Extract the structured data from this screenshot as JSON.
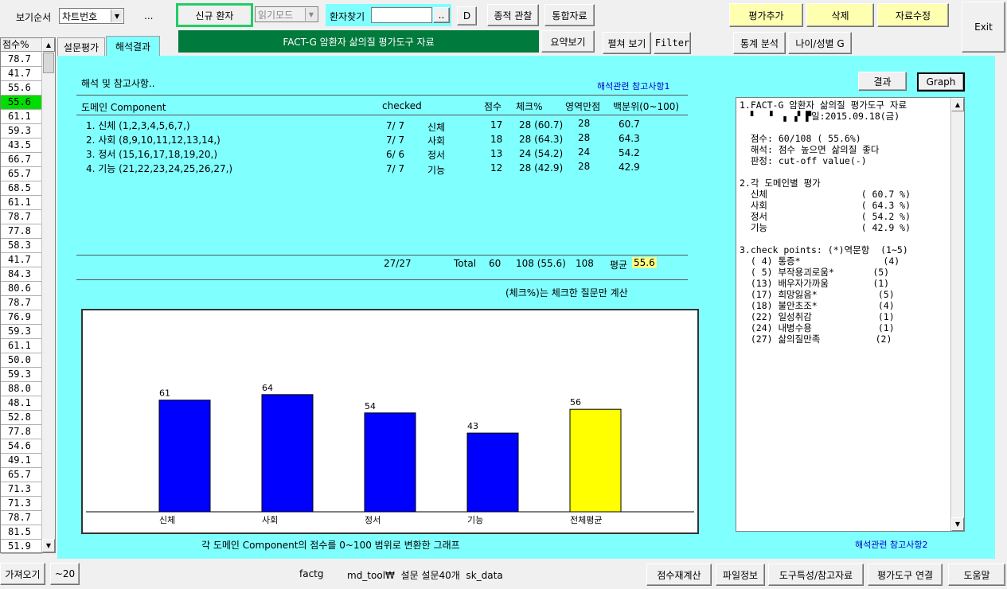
{
  "toolbar": {
    "sort_label": "보기순서",
    "sort_value": "차트번호",
    "ellipsis": "...",
    "new_patient": "신규 환자",
    "read_mode": "읽기모드",
    "search_label": "환자찾기",
    "search_value": "",
    "search_more": "..",
    "d_button": "D",
    "trend": "종적 관찰",
    "integrated": "통합자료",
    "add_eval": "평가추가",
    "delete": "삭제",
    "edit_data": "자료수정",
    "exit": "Exit",
    "title_banner": "FACT-G 암환자 삶의질 평가도구 자료",
    "summary": "요약보기",
    "expand": "펼쳐 보기",
    "filter": "Filter",
    "stats": "통계 분석",
    "age_sex": "나이/성별 G"
  },
  "score_list": {
    "header": "점수%",
    "selected_index": 3,
    "values": [
      "78.7",
      "41.7",
      "55.6",
      "55.6",
      "61.1",
      "59.3",
      "43.5",
      "66.7",
      "65.7",
      "68.5",
      "61.1",
      "78.7",
      "77.8",
      "58.3",
      "41.7",
      "84.3",
      "80.6",
      "78.7",
      "76.9",
      "59.3",
      "61.1",
      "50.0",
      "59.3",
      "88.0",
      "48.1",
      "52.8",
      "77.8",
      "54.6",
      "49.1",
      "65.7",
      "71.3",
      "71.3",
      "78.7",
      "81.5",
      "51.9"
    ]
  },
  "tabs": [
    {
      "label": "설문평가"
    },
    {
      "label": "해석결과"
    }
  ],
  "interpretation": {
    "heading": "해석 및 참고사항..",
    "ref_link_1": "해석관련 참고사항1",
    "ref_link_2": "해석관련 참고사항2",
    "result_button": "결과",
    "graph_button": "Graph",
    "columns": {
      "domain": "도메인 Component",
      "checked": "checked",
      "score": "점수",
      "check_pct": "체크%",
      "max": "영역만점",
      "percentile": "백분위(0~100)"
    },
    "rows": [
      {
        "domain": "1. 신체 (1,2,3,4,5,6,7,)",
        "checked": "7/ 7",
        "name": "신체",
        "score": "17",
        "check_pct": "28 (60.7)",
        "max": "28",
        "percentile": "60.7"
      },
      {
        "domain": "2. 사회 (8,9,10,11,12,13,14,)",
        "checked": "7/ 7",
        "name": "사회",
        "score": "18",
        "check_pct": "28 (64.3)",
        "max": "28",
        "percentile": "64.3"
      },
      {
        "domain": "3. 정서 (15,16,17,18,19,20,)",
        "checked": "6/ 6",
        "name": "정서",
        "score": "13",
        "check_pct": "24 (54.2)",
        "max": "24",
        "percentile": "54.2"
      },
      {
        "domain": "4. 기능 (21,22,23,24,25,26,27,)",
        "checked": "7/ 7",
        "name": "기능",
        "score": "12",
        "check_pct": "28 (42.9)",
        "max": "28",
        "percentile": "42.9"
      }
    ],
    "total": {
      "checked": "27/27",
      "label": "Total",
      "score": "60",
      "check_pct": "108 (55.6)",
      "max": "108",
      "avg_label": "평균",
      "avg_value": "55.6"
    },
    "note": "(체크%)는 체크한 질문만 계산",
    "chart_caption": "각 도메인 Component의 점수를 0~100 범위로 변환한 그래프"
  },
  "chart_data": {
    "type": "bar",
    "categories": [
      "신체",
      "사회",
      "정서",
      "기능",
      "전체평균"
    ],
    "values": [
      61,
      64,
      54,
      43,
      56
    ],
    "colors": [
      "#0000ff",
      "#0000ff",
      "#0000ff",
      "#0000ff",
      "#ffff00"
    ],
    "ylim": [
      0,
      100
    ],
    "title": "",
    "xlabel": "",
    "ylabel": ""
  },
  "memo": {
    "lines": [
      "1.FACT-G 암환자 삶의질 평가도구 자료",
      "  ▘  ▝  ▖ ▞ ▛일:2015.09.18(금)",
      "",
      "  점수: 60/108 ( 55.6%)",
      "  해석: 점수 높으면 삶의질 좋다",
      "  판정: cut-off value(-)",
      "",
      "2.각 도메인별 평가",
      "  신체                 ( 60.7 %)",
      "  사회                 ( 64.3 %)",
      "  정서                 ( 54.2 %)",
      "  기능                 ( 42.9 %)",
      "",
      "3.check points: (*)역문항  (1~5)",
      "  ( 4) 통증*               (4)",
      "  ( 5) 부작용괴로움*       (5)",
      "  (13) 배우자가까움        (1)",
      "  (17) 희망잃음*           (5)",
      "  (18) 불안초조*           (4)",
      "  (22) 일성취감            (1)",
      "  (24) 내병수용            (1)",
      "  (27) 삶의질만족          (2)"
    ]
  },
  "bottom": {
    "fetch": "가져오기",
    "minus20": "~20",
    "status_1": "factg",
    "status_2": "md_tool₩  설문 설문40개  sk_data",
    "recalc": "점수재계산",
    "file_info": "파일정보",
    "tool_ref": "도구특성/참고자료",
    "tool_link": "평가도구 연결",
    "help": "도움말"
  }
}
